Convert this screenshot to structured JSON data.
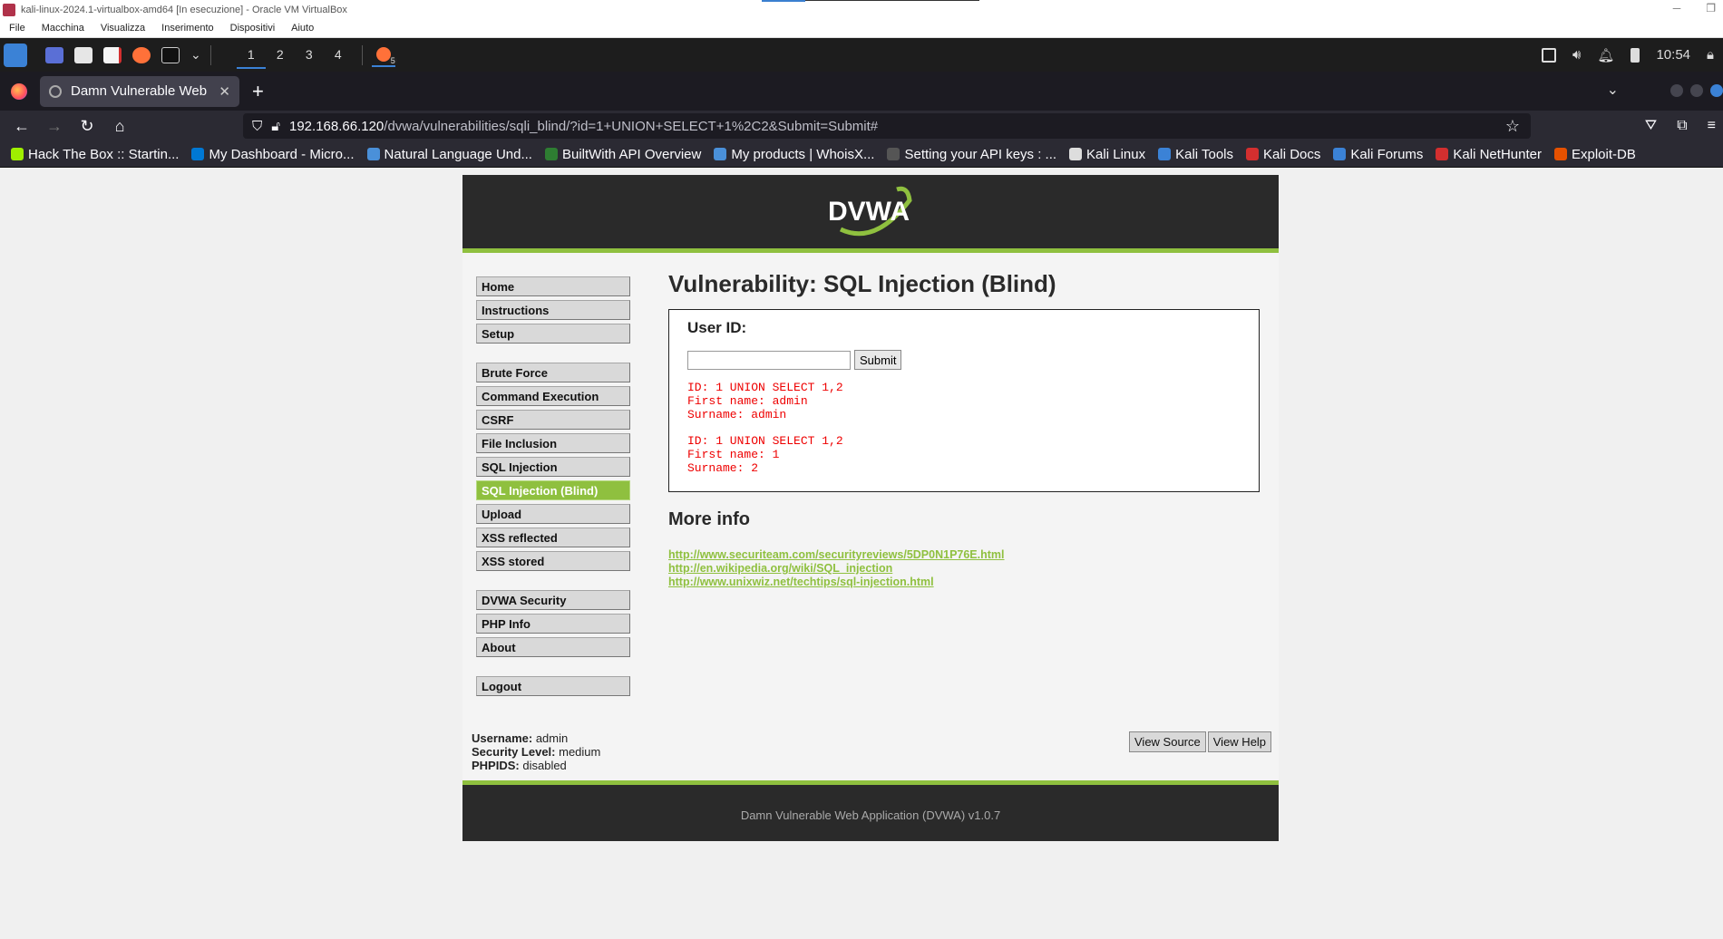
{
  "vbox": {
    "title": "kali-linux-2024.1-virtualbox-amd64 [In esecuzione] - Oracle VM VirtualBox",
    "menu": [
      "File",
      "Macchina",
      "Visualizza",
      "Inserimento",
      "Dispositivi",
      "Aiuto"
    ]
  },
  "panel": {
    "workspaces": [
      "1",
      "2",
      "3",
      "4"
    ],
    "clock": "10:54",
    "ff_badge": "5"
  },
  "browser": {
    "tab_title": "Damn Vulnerable Web Ap",
    "url_host": "192.168.66.120",
    "url_path": "/dvwa/vulnerabilities/sqli_blind/?id=1+UNION+SELECT+1%2C2&Submit=Submit#",
    "bookmarks": [
      {
        "label": "Hack The Box :: Startin...",
        "color": "#9fef00"
      },
      {
        "label": "My Dashboard - Micro...",
        "color": "#0078d4"
      },
      {
        "label": "Natural Language Und...",
        "color": "#4a90d9"
      },
      {
        "label": "BuiltWith API Overview",
        "color": "#2e7d32"
      },
      {
        "label": "My products | WhoisX...",
        "color": "#4a90d9"
      },
      {
        "label": "Setting your API keys : ...",
        "color": "#555555"
      },
      {
        "label": "Kali Linux",
        "color": "#dddddd"
      },
      {
        "label": "Kali Tools",
        "color": "#3b82d6"
      },
      {
        "label": "Kali Docs",
        "color": "#d32f2f"
      },
      {
        "label": "Kali Forums",
        "color": "#3b82d6"
      },
      {
        "label": "Kali NetHunter",
        "color": "#d32f2f"
      },
      {
        "label": "Exploit-DB",
        "color": "#e65100"
      }
    ]
  },
  "dvwa": {
    "logo": "DVWA",
    "menu_group1": [
      "Home",
      "Instructions",
      "Setup"
    ],
    "menu_group2": [
      "Brute Force",
      "Command Execution",
      "CSRF",
      "File Inclusion",
      "SQL Injection",
      "SQL Injection (Blind)",
      "Upload",
      "XSS reflected",
      "XSS stored"
    ],
    "menu_group3": [
      "DVWA Security",
      "PHP Info",
      "About"
    ],
    "menu_group4": [
      "Logout"
    ],
    "selected": "SQL Injection (Blind)",
    "heading": "Vulnerability: SQL Injection (Blind)",
    "form_label": "User ID:",
    "input_value": "",
    "submit_label": "Submit",
    "results": [
      {
        "id": "ID: 1 UNION SELECT 1,2",
        "first": "First name: admin",
        "sur": "Surname: admin"
      },
      {
        "id": "ID: 1 UNION SELECT 1,2",
        "first": "First name: 1",
        "sur": "Surname: 2"
      }
    ],
    "more_info": "More info",
    "links": [
      "http://www.securiteam.com/securityreviews/5DP0N1P76E.html",
      "http://en.wikipedia.org/wiki/SQL_injection",
      "http://www.unixwiz.net/techtips/sql-injection.html"
    ],
    "user": {
      "username_label": "Username:",
      "username": "admin",
      "level_label": "Security Level:",
      "level": "medium",
      "phpids_label": "PHPIDS:",
      "phpids": "disabled"
    },
    "view_source": "View Source",
    "view_help": "View Help",
    "footer": "Damn Vulnerable Web Application (DVWA) v1.0.7"
  }
}
